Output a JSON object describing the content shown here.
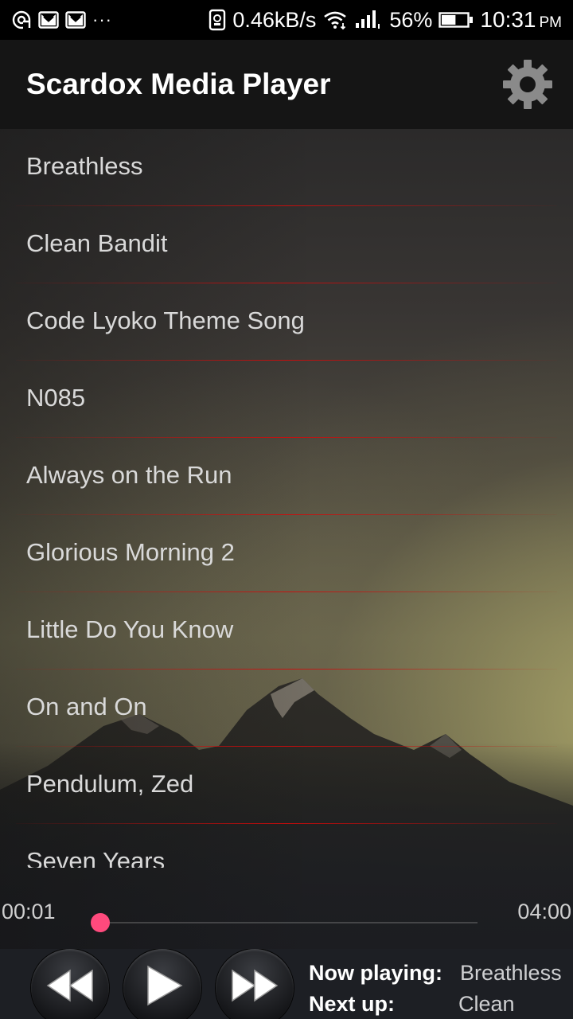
{
  "status_bar": {
    "left_icons": [
      "camera-target-icon",
      "gmail-icon",
      "gmail-icon"
    ],
    "overflow": "···",
    "network_speed": "0.46kB/s",
    "signal_icons": [
      "phone-icon",
      "wifi-icon",
      "cell-signal-icon"
    ],
    "battery": "56%",
    "battery_level": 0.56,
    "time": "10:31",
    "am_pm": "PM"
  },
  "app_bar": {
    "title": "Scardox Media Player",
    "settings_icon": "gear-icon"
  },
  "playlist": [
    "Breathless",
    "Clean Bandit",
    "Code Lyoko Theme Song",
    "N085",
    "Always on the Run",
    "Glorious Morning 2",
    "Little Do You Know",
    "On and On",
    "Pendulum, Zed",
    "Seven Years"
  ],
  "player": {
    "elapsed": "00:01",
    "total": "04:00",
    "progress": 0.004,
    "controls": [
      "rewind-icon",
      "play-icon",
      "fast-forward-icon"
    ],
    "now_playing_label": "Now playing:",
    "now_playing_value": "Breathless",
    "next_up_label": "Next up:",
    "next_up_value": "Clean"
  },
  "colors": {
    "accent": "#ff4a7d",
    "divider": "#d20a0a",
    "app_bar": "#151515",
    "control_bg": "#1d1f24"
  }
}
